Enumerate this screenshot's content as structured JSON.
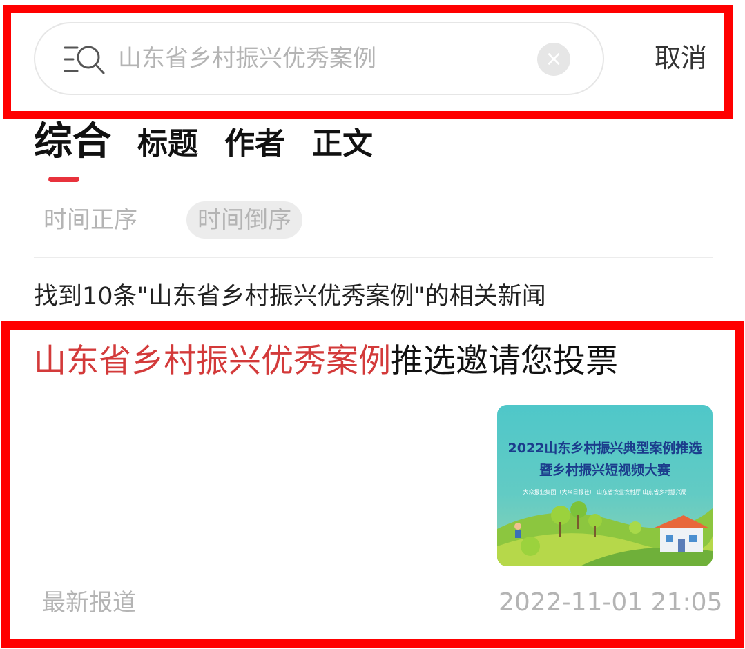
{
  "search": {
    "query": "山东省乡村振兴优秀案例",
    "clear_icon": "×",
    "cancel_label": "取消"
  },
  "tabs": [
    {
      "label": "综合",
      "active": true
    },
    {
      "label": "标题",
      "active": false
    },
    {
      "label": "作者",
      "active": false
    },
    {
      "label": "正文",
      "active": false
    }
  ],
  "sort": {
    "ascending_label": "时间正序",
    "descending_label": "时间倒序",
    "selected": "时间倒序"
  },
  "results": {
    "summary": "找到10条\"山东省乡村振兴优秀案例\"的相关新闻"
  },
  "article": {
    "title_highlight": "山东省乡村振兴优秀案例",
    "title_rest": "推选邀请您投票",
    "thumbnail": {
      "line1": "2022山东乡村振兴典型案例推选",
      "line2": "暨乡村振兴短视频大赛",
      "line3": "大众报业集团（大众日报社）  山东省农业农村厅  山东省乡村振兴局"
    },
    "source": "最新报道",
    "timestamp": "2022-11-01 21:05"
  },
  "colors": {
    "accent_red": "#e8323c",
    "highlight_red": "#d33a3a",
    "annotation_frame": "#ff0000",
    "muted_text": "#b4b4b4"
  },
  "icons": {
    "search": "search-list-icon",
    "clear": "clear-circle-icon"
  }
}
